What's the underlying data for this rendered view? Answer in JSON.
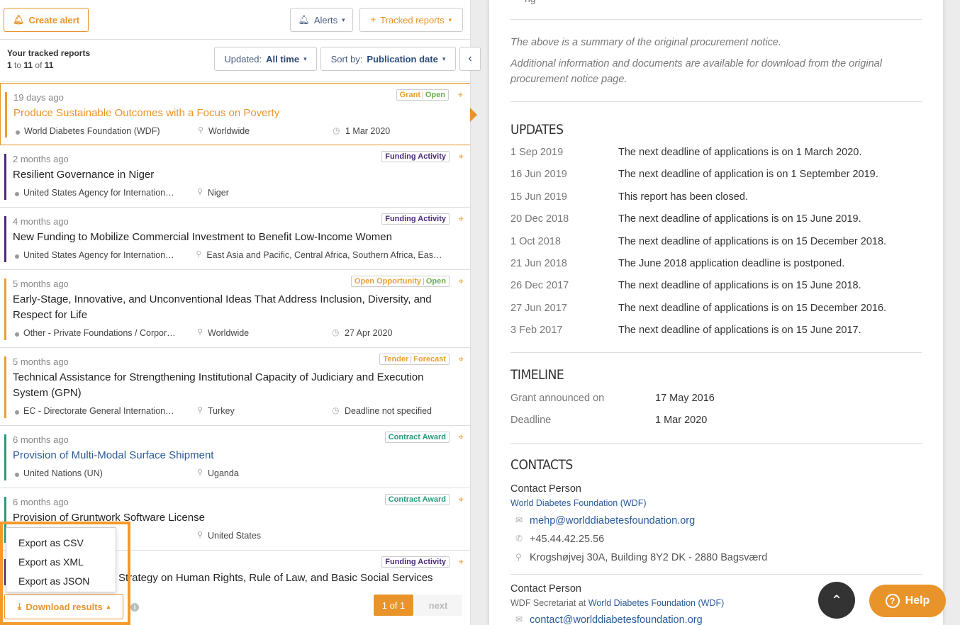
{
  "toolbar": {
    "create_alert": "Create alert",
    "alerts": "Alerts",
    "tracked_reports": "Tracked reports"
  },
  "subbar": {
    "title": "Your tracked reports",
    "count_from": "1",
    "count_to_word": "to",
    "count_to": "11",
    "count_of_word": "of",
    "count_total": "11",
    "updated_label": "Updated:",
    "updated_value": "All time",
    "sort_label": "Sort by:",
    "sort_value": "Publication date"
  },
  "items": [
    {
      "ago": "19 days ago",
      "title": "Produce Sustainable Outcomes with a Focus on Poverty",
      "org": "World Diabetes Foundation (WDF)",
      "loc": "Worldwide",
      "date": "1 Mar 2020",
      "badge1": "Grant",
      "badge2": "Open"
    },
    {
      "ago": "2 months ago",
      "title": "Resilient Governance in Niger",
      "org": "United States Agency for Internation…",
      "loc": "Niger",
      "badge1": "Funding Activity"
    },
    {
      "ago": "4 months ago",
      "title": "New Funding to Mobilize Commercial Investment to Benefit Low-Income Women",
      "org": "United States Agency for Internation…",
      "loc": "East Asia and Pacific, Central Africa, Southern Africa, Eas…",
      "badge1": "Funding Activity"
    },
    {
      "ago": "5 months ago",
      "title": "Early-Stage, Innovative, and Unconventional Ideas That Address Inclusion, Diversity, and Respect for Life",
      "org": "Other - Private Foundations / Corpor…",
      "loc": "Worldwide",
      "date": "27 Apr 2020",
      "badge1": "Open Opportunity",
      "badge2": "Open"
    },
    {
      "ago": "5 months ago",
      "title": "Technical Assistance for Strengthening Institutional Capacity of Judiciary and Execution System (GPN)",
      "org": "EC - Directorate General Internation…",
      "loc": "Turkey",
      "date": "Deadline not specified",
      "badge1": "Tender",
      "badge2": "Forecast"
    },
    {
      "ago": "6 months ago",
      "title": "Provision of Multi-Modal Surface Shipment",
      "org": "United Nations (UN)",
      "loc": "Uganda",
      "badge1": "Contract Award"
    },
    {
      "ago": "6 months ago",
      "title": "Provision of Gruntwork Software License",
      "org": "",
      "loc": "United States",
      "badge1": "Contract Award"
    },
    {
      "ago": "",
      "title": "Strategy on Human Rights, Rule of Law, and Basic Social Services",
      "badge1": "Funding Activity"
    }
  ],
  "export_menu": [
    "Export as CSV",
    "Export as XML",
    "Export as JSON"
  ],
  "bottom": {
    "download": "Download results",
    "info": "i",
    "page": "1 of 1",
    "next": "next"
  },
  "detail": {
    "top_fragment": "ng",
    "note1": "The above is a summary of the original procurement notice.",
    "note2": "Additional information and documents are available for download from the original procurement notice page.",
    "updates_title": "Updates",
    "updates": [
      {
        "d": "1 Sep 2019",
        "t": "The next deadline of applications is on 1 March 2020."
      },
      {
        "d": "16 Jun 2019",
        "t": "The next deadline of application is on 1 September 2019."
      },
      {
        "d": "15 Jun 2019",
        "t": "This report has been closed."
      },
      {
        "d": "20 Dec 2018",
        "t": "The next deadline of applications is on 15 June 2019."
      },
      {
        "d": "1 Oct 2018",
        "t": "The next deadline of applications is on 15 December 2018."
      },
      {
        "d": "21 Jun 2018",
        "t": "The June 2018 application deadline is postponed."
      },
      {
        "d": "26 Dec 2017",
        "t": "The next deadline of applications is on 15 June 2018."
      },
      {
        "d": "27 Jun 2017",
        "t": "The next deadline of applications is on 15 December 2016."
      },
      {
        "d": "3 Feb 2017",
        "t": "The next deadline of applications is on 15 June 2017."
      }
    ],
    "timeline_title": "Timeline",
    "timeline": [
      {
        "k": "Grant announced on",
        "v": "17 May 2016"
      },
      {
        "k": "Deadline",
        "v": "1 Mar 2020"
      }
    ],
    "contacts_title": "Contacts",
    "contact1": {
      "heading": "Contact Person",
      "org": "World Diabetes Foundation (WDF)",
      "email": "mehp@worlddiabetesfoundation.org",
      "phone": "+45.44.42.25.56",
      "address": "Krogshøjvej 30A, Building 8Y2 DK - 2880 Bagsværd"
    },
    "contact2": {
      "heading": "Contact Person",
      "org_prefix": "WDF Secretariat at",
      "org": "World Diabetes Foundation (WDF)",
      "email": "contact@worlddiabetesfoundation.org"
    }
  },
  "help": {
    "label": "Help",
    "q": "?"
  },
  "colors": {
    "accent": "#e8942a",
    "link": "#2a5a9a",
    "grant_bar": "#e8a030",
    "funding_bar": "#4a2a7a",
    "award_bar": "#2a9a7a"
  }
}
